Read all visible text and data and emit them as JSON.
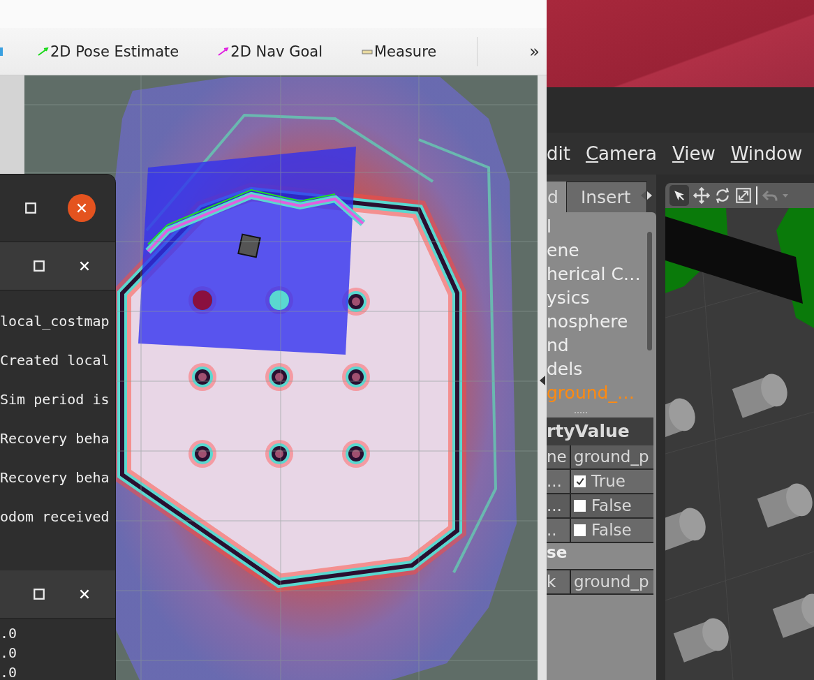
{
  "rviz": {
    "toolbar": [
      {
        "kind": "pose",
        "label": "2D Pose Estimate"
      },
      {
        "kind": "goal",
        "label": "2D Nav Goal"
      },
      {
        "kind": "measure",
        "label": "Measure"
      }
    ],
    "overflow": "»"
  },
  "terminals": [
    {
      "active": true
    },
    {
      "active": false,
      "lines": [
        "local_costmap",
        "Created local",
        "Sim period is",
        "Recovery beha",
        "Recovery beha",
        "odom received"
      ]
    },
    {
      "active": false,
      "lines": [
        ".0",
        ".0",
        ".0"
      ]
    }
  ],
  "gazebo": {
    "menu": [
      {
        "label": "dit",
        "mnemonic": false
      },
      {
        "label": "Camera",
        "mnemonic": true
      },
      {
        "label": "View",
        "mnemonic": true
      },
      {
        "label": "Window",
        "mnemonic": true
      }
    ],
    "tabs": [
      {
        "label": "d",
        "selected": true
      },
      {
        "label": "Insert",
        "selected": false
      }
    ],
    "tree": [
      {
        "label": "l",
        "selected": false
      },
      {
        "label": "ene",
        "selected": false
      },
      {
        "label": "herical C…",
        "selected": false
      },
      {
        "label": "ysics",
        "selected": false
      },
      {
        "label": "nosphere",
        "selected": false
      },
      {
        "label": "nd",
        "selected": false
      },
      {
        "label": "dels",
        "selected": false
      },
      {
        "label": "ground_…",
        "selected": true
      }
    ],
    "properties": {
      "header": "rtyValue",
      "rows": [
        {
          "kind": "text",
          "name": "ne",
          "value": "ground_p"
        },
        {
          "kind": "check",
          "name": "...",
          "checked": true,
          "value": "True"
        },
        {
          "kind": "check",
          "name": "...",
          "checked": false,
          "value": "False"
        },
        {
          "kind": "check",
          "name": "..",
          "checked": false,
          "value": "False"
        },
        {
          "kind": "group",
          "name": "se"
        },
        {
          "kind": "text",
          "name": "k",
          "value": "ground_p"
        }
      ]
    }
  }
}
